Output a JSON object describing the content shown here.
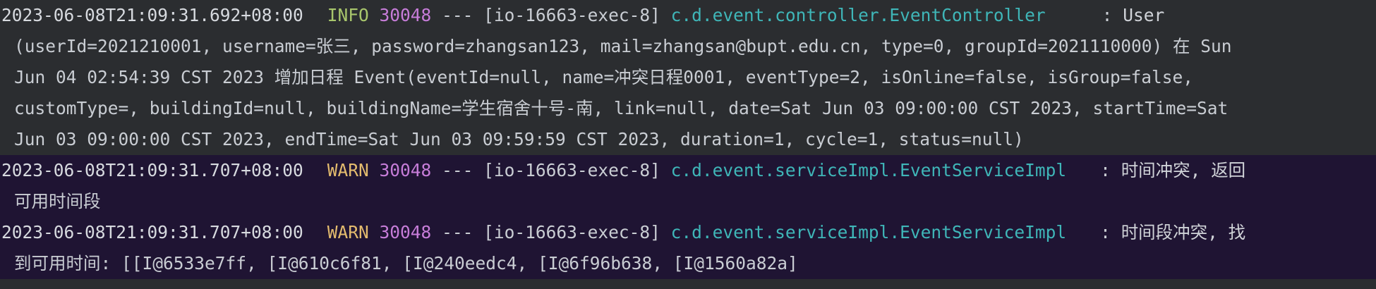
{
  "entries": [
    {
      "timestamp": "2023-06-08T21:09:31.692+08:00",
      "level": "INFO",
      "pid": "30048",
      "separator": "---",
      "thread": "[io-16663-exec-8]",
      "logger": "c.d.event.controller.EventController",
      "colon": ":",
      "message_first": "User",
      "message_cont": [
        "(userId=2021210001, username=张三, password=zhangsan123, mail=zhangsan@bupt.edu.cn, type=0, groupId=2021110000) 在 Sun",
        "Jun 04 02:54:39 CST 2023 增加日程 Event(eventId=null, name=冲突日程0001, eventType=2, isOnline=false, isGroup=false,",
        "customType=, buildingId=null, buildingName=学生宿舍十号-南, link=null, date=Sat Jun 03 09:00:00 CST 2023, startTime=Sat",
        "Jun 03 09:00:00 CST 2023, endTime=Sat Jun 03 09:59:59 CST 2023, duration=1, cycle=1, status=null)"
      ]
    },
    {
      "timestamp": "2023-06-08T21:09:31.707+08:00",
      "level": "WARN",
      "pid": "30048",
      "separator": "---",
      "thread": "[io-16663-exec-8]",
      "logger": "c.d.event.serviceImpl.EventServiceImpl",
      "colon": ":",
      "message_first": "时间冲突, 返回",
      "message_cont": [
        "可用时间段"
      ]
    },
    {
      "timestamp": "2023-06-08T21:09:31.707+08:00",
      "level": "WARN",
      "pid": "30048",
      "separator": "---",
      "thread": "[io-16663-exec-8]",
      "logger": "c.d.event.serviceImpl.EventServiceImpl",
      "colon": ":",
      "message_first": "时间段冲突, 找",
      "message_cont": [
        "到可用时间: [[I@6533e7ff, [I@610c6f81, [I@240eedc4, [I@6f96b638, [I@1560a82a]"
      ]
    }
  ],
  "colors": {
    "background": "#2b2d30",
    "warn_background": "#1f1433",
    "info_level": "#a8c66c",
    "warn_level": "#e3bb6e",
    "pid": "#c77dd9",
    "logger": "#3fb6b8",
    "text": "#c9cdd3"
  }
}
